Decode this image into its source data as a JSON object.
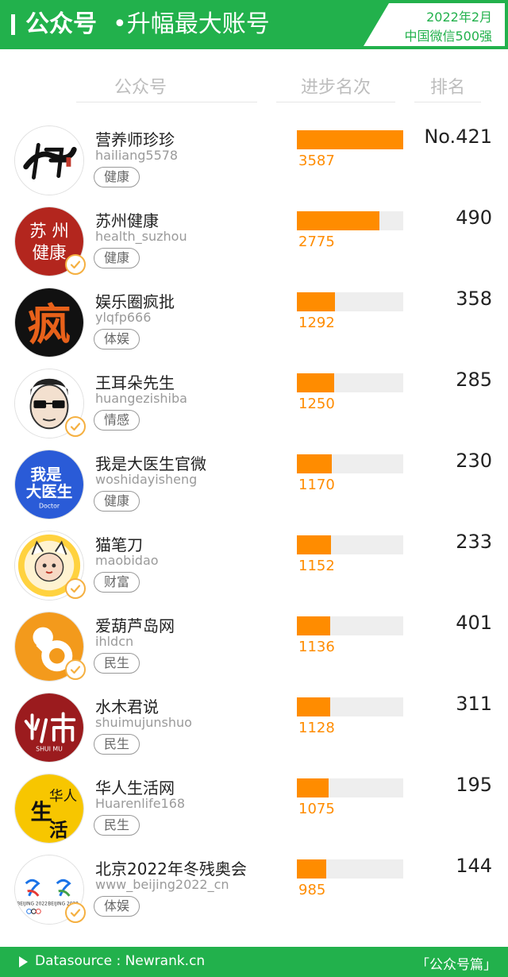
{
  "header": {
    "title_main": "公众号",
    "title_sub": "•升幅最大账号",
    "period": "2022年2月",
    "subtitle": "中国微信500强"
  },
  "columns": {
    "account": "公众号",
    "progress": "进步名次",
    "rank": "排名"
  },
  "rows": [
    {
      "name": "营养师珍珍",
      "handle": "hailiang5578",
      "tag": "健康",
      "progress": 3587,
      "progress_label": "3587",
      "rank": "No.421",
      "verified": false,
      "avatar": "jian-calligraphy-icon"
    },
    {
      "name": "苏州健康",
      "handle": "health_suzhou",
      "tag": "健康",
      "progress": 2775,
      "progress_label": "2775",
      "rank": "490",
      "verified": true,
      "avatar": "suzhou-jiankang-icon"
    },
    {
      "name": "娱乐圈疯批",
      "handle": "ylqfp666",
      "tag": "体娱",
      "progress": 1292,
      "progress_label": "1292",
      "rank": "358",
      "verified": false,
      "avatar": "feng-character-icon"
    },
    {
      "name": "王耳朵先生",
      "handle": "huangezishiba",
      "tag": "情感",
      "progress": 1250,
      "progress_label": "1250",
      "rank": "285",
      "verified": true,
      "avatar": "cartoon-man-sunglasses-icon"
    },
    {
      "name": "我是大医生官微",
      "handle": "woshidayisheng",
      "tag": "健康",
      "progress": 1170,
      "progress_label": "1170",
      "rank": "230",
      "verified": false,
      "avatar": "doctor-logo-icon"
    },
    {
      "name": "猫笔刀",
      "handle": "maobidao",
      "tag": "财富",
      "progress": 1152,
      "progress_label": "1152",
      "rank": "233",
      "verified": true,
      "avatar": "cartoon-cat-child-icon"
    },
    {
      "name": "爱葫芦岛网",
      "handle": "ihldcn",
      "tag": "民生",
      "progress": 1136,
      "progress_label": "1136",
      "rank": "401",
      "verified": true,
      "avatar": "gourd-logo-icon"
    },
    {
      "name": "水木君说",
      "handle": "shuimujunshuo",
      "tag": "民生",
      "progress": 1128,
      "progress_label": "1128",
      "rank": "311",
      "verified": false,
      "avatar": "shuimu-logo-icon"
    },
    {
      "name": "华人生活网",
      "handle": "Huarenlife168",
      "tag": "民生",
      "progress": 1075,
      "progress_label": "1075",
      "rank": "195",
      "verified": false,
      "avatar": "huaren-shenghuo-icon"
    },
    {
      "name": "北京2022年冬残奥会",
      "handle": "www_beijing2022_cn",
      "tag": "体娱",
      "progress": 985,
      "progress_label": "985",
      "rank": "144",
      "verified": true,
      "avatar": "beijing-2022-emblem-icon"
    }
  ],
  "progress_max": 3587,
  "footer": {
    "source": "Datasource : Newrank.cn",
    "category": "「公众号篇」"
  },
  "colors": {
    "brand_green": "#22b14c",
    "bar_orange": "#ff8c00",
    "track_gray": "#eeeeee"
  }
}
